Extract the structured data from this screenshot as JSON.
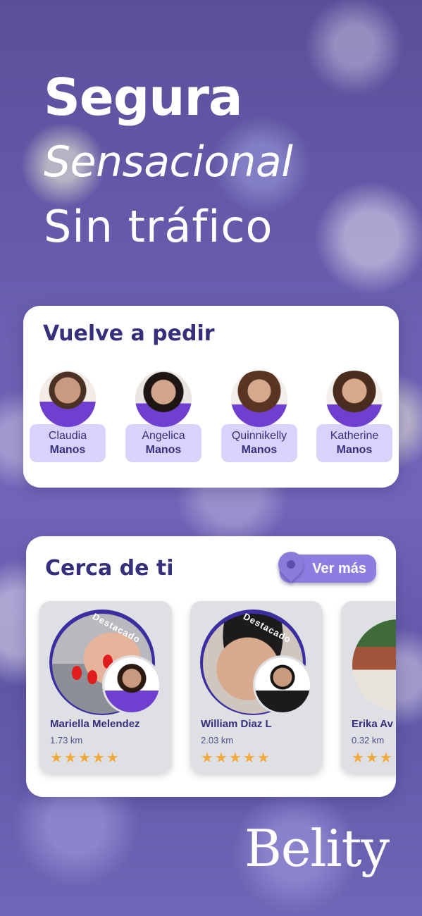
{
  "headline": {
    "line1": "Segura",
    "line2": "Sensacional",
    "line3": "Sin tráfico"
  },
  "reorder": {
    "title": "Vuelve a pedir",
    "items": [
      {
        "name": "Claudia",
        "role": "Manos"
      },
      {
        "name": "Angelica",
        "role": "Manos"
      },
      {
        "name": "Quinnikelly",
        "role": "Manos"
      },
      {
        "name": "Katherine",
        "role": "Manos"
      }
    ]
  },
  "nearby": {
    "title": "Cerca de ti",
    "see_more": "Ver más",
    "badge": "Destacado",
    "items": [
      {
        "name": "Mariella Melendez",
        "distance": "1.73 km",
        "stars": "★★★★★"
      },
      {
        "name": "William Diaz L",
        "distance": "2.03 km",
        "stars": "★★★★★"
      },
      {
        "name": "Erika Av",
        "distance": "0.32 km",
        "stars": "★★★"
      }
    ]
  },
  "brand": {
    "logo": "Belity"
  },
  "colors": {
    "accent": "#352f7c",
    "tag_bg": "#d9d2fb",
    "button": "#8c7ee0",
    "star": "#f2a93b"
  }
}
